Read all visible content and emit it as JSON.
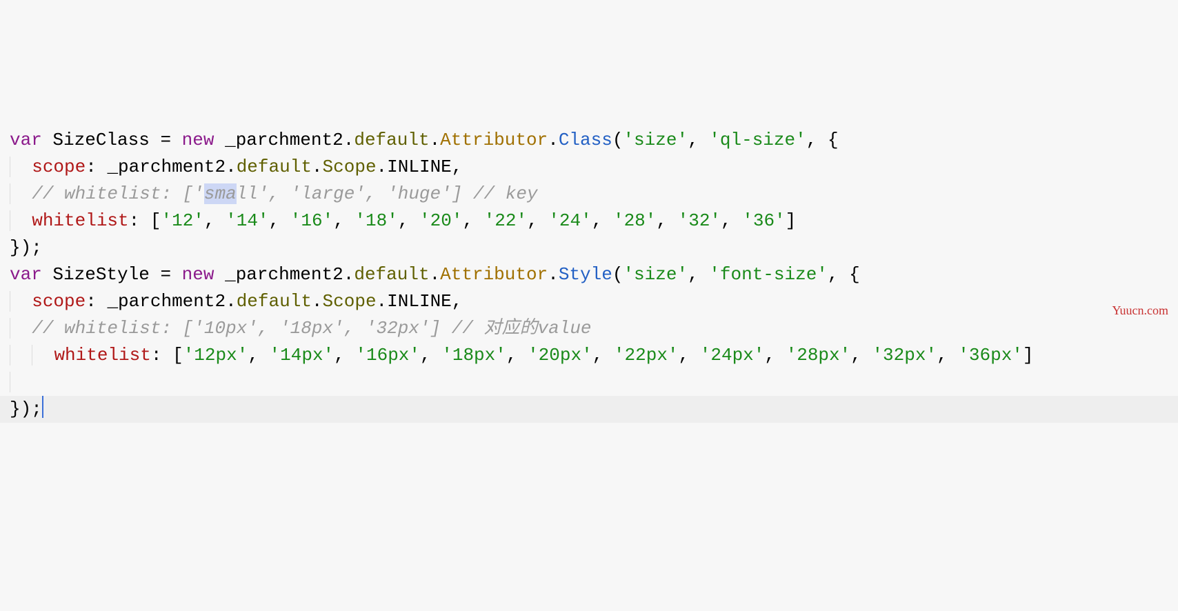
{
  "watermark": "Yuucn.com",
  "c": {
    "var": "var",
    "new": "new",
    "SizeClass": "SizeClass",
    "SizeStyle": "SizeStyle",
    "eq": " = ",
    "parch": "_parchment2",
    "dot": ".",
    "def": "default",
    "Attr": "Attributor",
    "Class": "Class",
    "Style": "Style",
    "Scope": "Scope",
    "INLINE": "INLINE",
    "scope": "scope",
    "whitelist": "whitelist",
    "colon": ": ",
    "comma": ", ",
    "commaT": ",",
    "open": "(",
    "close": ")",
    "obr": "{",
    "cbr": "}",
    "osq": "[",
    "csq": "]",
    "semi": ";",
    "s_size": "'size'",
    "s_qlsize": "'ql-size'",
    "s_fontsize": "'font-size'",
    "com1_a": "// whitelist: ['",
    "com1_sma": "sma",
    "com1_b": "ll', 'large', 'huge'] // key",
    "com2": "// whitelist: ['10px', '18px', '32px'] // 对应的value",
    "wl1": [
      "'12'",
      "'14'",
      "'16'",
      "'18'",
      "'20'",
      "'22'",
      "'24'",
      "'28'",
      "'32'",
      "'36'"
    ],
    "wl2": [
      "'12px'",
      "'14px'",
      "'16px'",
      "'18px'",
      "'20px'",
      "'22px'",
      "'24px'",
      "'28px'",
      "'32px'",
      "'36px'"
    ]
  }
}
